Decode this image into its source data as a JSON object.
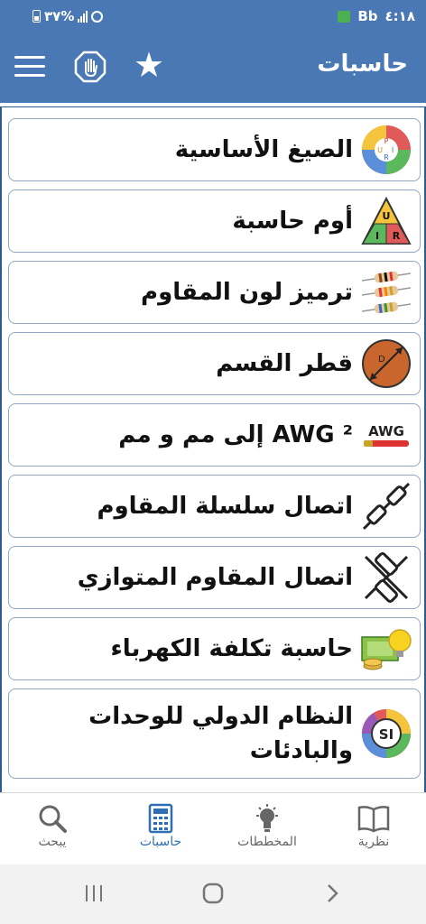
{
  "status_bar": {
    "battery": "٣٧%",
    "time": "٤:١٨",
    "carrier_badge": "Bb"
  },
  "app_bar": {
    "title": "حاسبات",
    "menu_icon": "menu-icon",
    "stop_icon": "hand-stop-icon",
    "favorite_icon": "star-icon"
  },
  "calculators": [
    {
      "label": "الصيغ الأساسية",
      "icon": "formula-wheel-icon"
    },
    {
      "label": "أوم حاسبة",
      "icon": "ohm-triangle-icon"
    },
    {
      "label": "ترميز لون المقاوم",
      "icon": "resistor-color-icon"
    },
    {
      "label": "قطر القسم",
      "icon": "cross-section-diameter-icon"
    },
    {
      "label": "AWG ² إلى مم و مم",
      "icon": "awg-cable-icon"
    },
    {
      "label": "اتصال سلسلة المقاوم",
      "icon": "series-resistor-icon"
    },
    {
      "label": "اتصال المقاوم المتوازي",
      "icon": "parallel-resistor-icon"
    },
    {
      "label": "حاسبة تكلفة الكهرباء",
      "icon": "electricity-cost-icon"
    },
    {
      "label_line1": "النظام الدولي للوحدات",
      "label_line2": "والبادئات",
      "icon": "si-units-icon"
    }
  ],
  "bottom_nav": [
    {
      "label": "نظرية",
      "icon": "book-icon",
      "active": false
    },
    {
      "label": "المخططات",
      "icon": "bulb-icon",
      "active": false
    },
    {
      "label": "حاسبات",
      "icon": "calculator-icon",
      "active": true
    },
    {
      "label": "يبحث",
      "icon": "search-icon",
      "active": false
    }
  ],
  "icon_texts": {
    "formula_letters": [
      "P",
      "I",
      "R",
      "U"
    ],
    "ohm_letters": [
      "U",
      "I",
      "R"
    ],
    "section_letter": "D",
    "awg_text": "AWG",
    "si_text": "SI"
  },
  "colors": {
    "app_bar": "#4a78b5",
    "active_nav": "#2e6fb3",
    "card_border": "#8fa6c4"
  }
}
